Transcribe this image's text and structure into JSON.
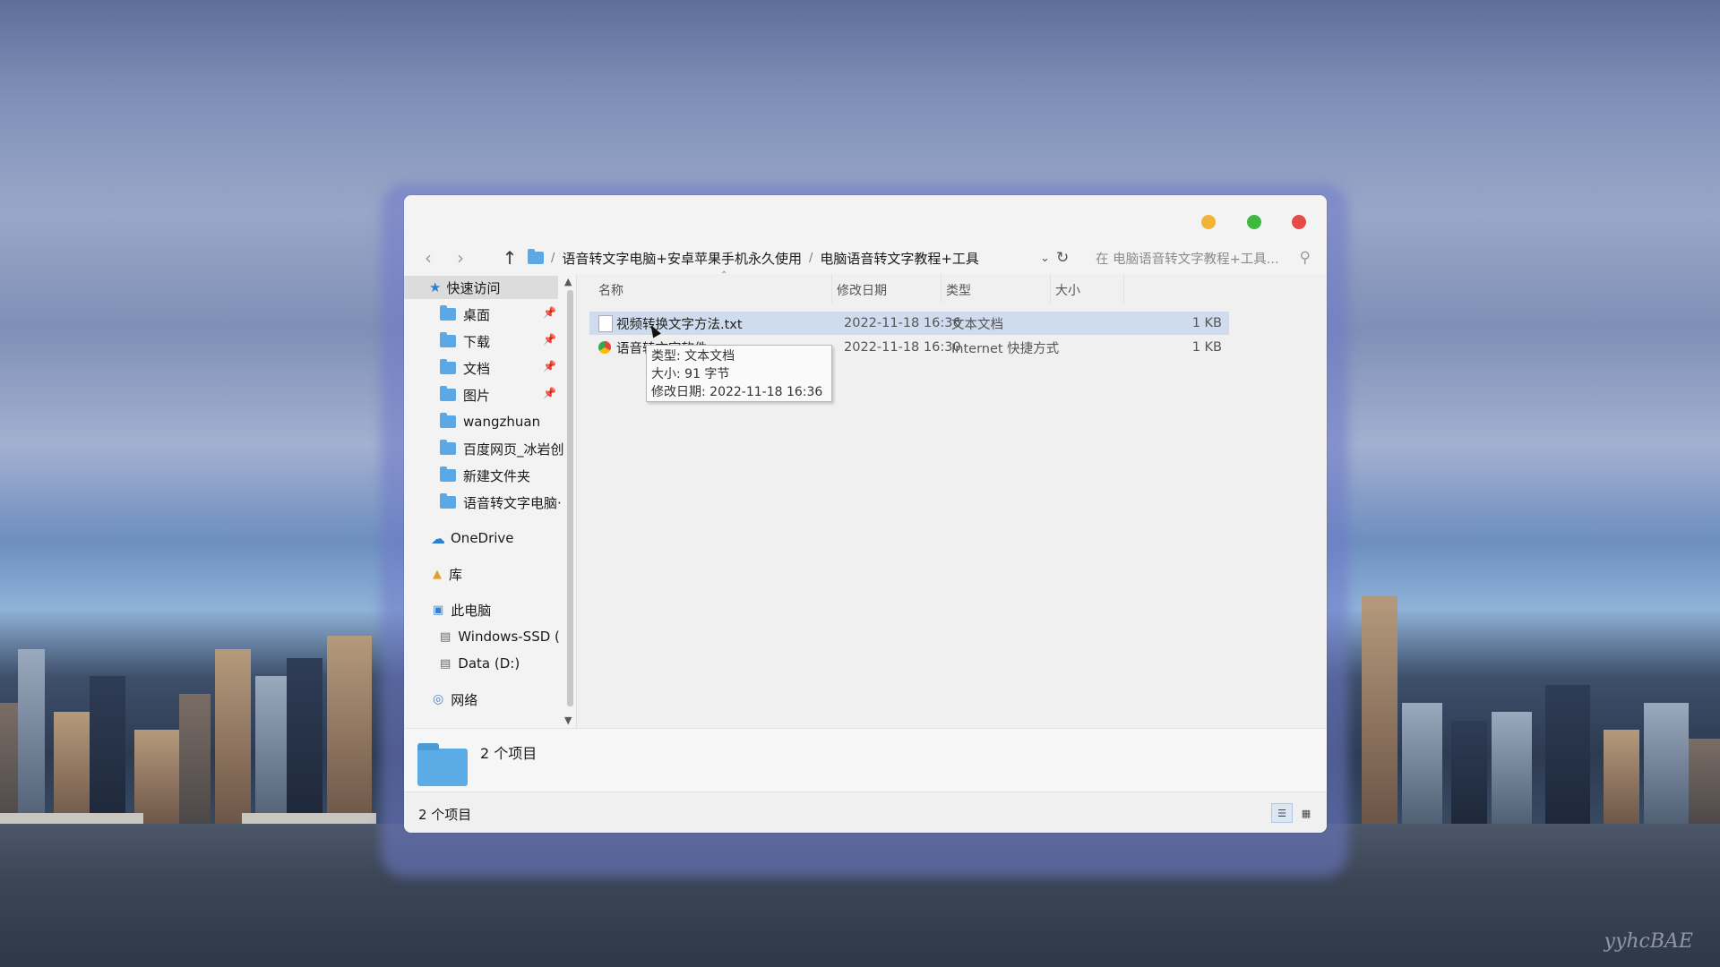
{
  "window": {
    "nav": {
      "path": [
        "语音转文字电脑+安卓苹果手机永久使用",
        "电脑语音转文字教程+工具"
      ],
      "search_placeholder": "在 电脑语音转文字教程+工具..."
    },
    "sidebar": {
      "quick_access": "快速访问",
      "items": [
        {
          "label": "桌面",
          "pinned": true
        },
        {
          "label": "下载",
          "pinned": true
        },
        {
          "label": "文档",
          "pinned": true
        },
        {
          "label": "图片",
          "pinned": true
        },
        {
          "label": "wangzhuan"
        },
        {
          "label": "百度网页_冰岩创"
        },
        {
          "label": "新建文件夹"
        },
        {
          "label": "语音转文字电脑·"
        }
      ],
      "onedrive": "OneDrive",
      "library": "库",
      "this_pc": "此电脑",
      "drives": [
        "Windows-SSD (",
        "Data (D:)"
      ],
      "network": "网络"
    },
    "columns": {
      "name": "名称",
      "date": "修改日期",
      "type": "类型",
      "size": "大小"
    },
    "files": [
      {
        "name": "视频转换文字方法.txt",
        "date": "2022-11-18 16:36",
        "type": "文本文档",
        "size": "1 KB",
        "icon": "text-file-icon"
      },
      {
        "name": "语音转文字软件",
        "date": "2022-11-18 16:30",
        "type": "Internet 快捷方式",
        "size": "1 KB",
        "icon": "internet-shortcut-icon"
      }
    ],
    "tooltip": {
      "type": "类型: 文本文档",
      "size": "大小: 91 字节",
      "modified": "修改日期: 2022-11-18 16:36"
    },
    "details": {
      "count": "2 个项目"
    },
    "status": {
      "count": "2 个项目"
    }
  },
  "desktop": {
    "signature": "yyhcBAE"
  },
  "colors": {
    "folder": "#5aa9e6",
    "selected_row": "#cfdcee",
    "close": "#e84a4a",
    "minimize": "#f2b233",
    "maximize": "#3fb83f"
  }
}
